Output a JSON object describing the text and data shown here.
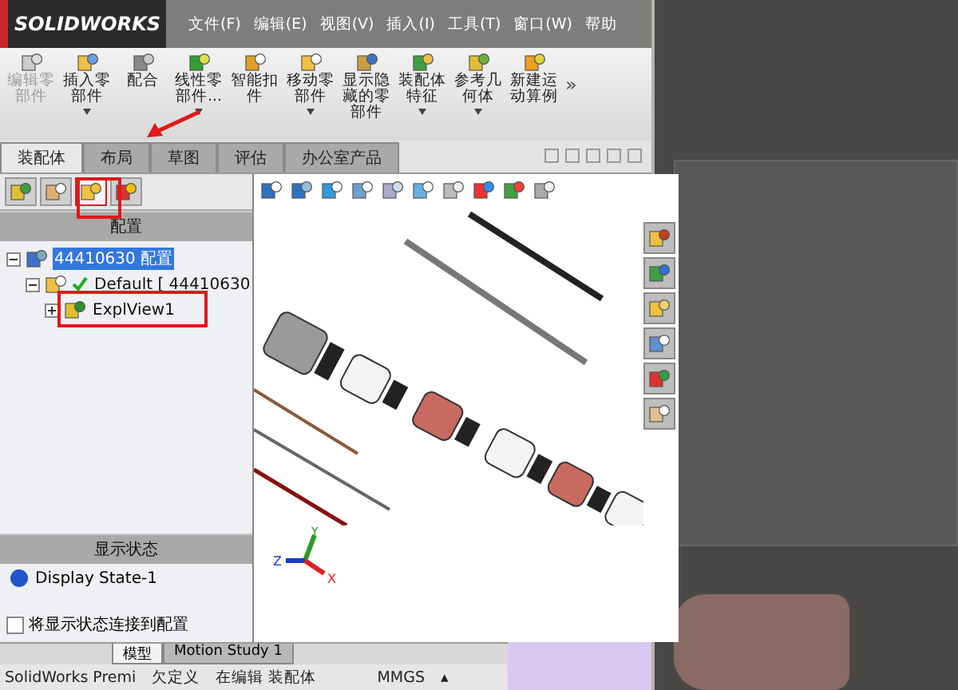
{
  "app": {
    "logo": "SOLIDWORKS",
    "menu": [
      "文件(F)",
      "编辑(E)",
      "视图(V)",
      "插入(I)",
      "工具(T)",
      "窗口(W)",
      "帮助"
    ]
  },
  "toolbar": {
    "buttons": [
      {
        "label": "编辑零部件",
        "disabled": true,
        "dropdown": false
      },
      {
        "label": "插入零部件",
        "disabled": false,
        "dropdown": true
      },
      {
        "label": "配合",
        "disabled": false,
        "dropdown": false
      },
      {
        "label": "线性零部件...",
        "disabled": false,
        "dropdown": true
      },
      {
        "label": "智能扣件",
        "disabled": false,
        "dropdown": false
      },
      {
        "label": "移动零部件",
        "disabled": false,
        "dropdown": true
      },
      {
        "label": "显示隐藏的零部件",
        "disabled": false,
        "dropdown": false
      },
      {
        "label": "装配体特征",
        "disabled": false,
        "dropdown": true
      },
      {
        "label": "参考几何体",
        "disabled": false,
        "dropdown": true
      },
      {
        "label": "新建运动算例",
        "disabled": false,
        "dropdown": false
      }
    ],
    "more": "»"
  },
  "tabs": [
    {
      "label": "装配体",
      "selected": true
    },
    {
      "label": "布局",
      "selected": false
    },
    {
      "label": "草图",
      "selected": false
    },
    {
      "label": "评估",
      "selected": false
    },
    {
      "label": "办公室产品",
      "selected": false
    }
  ],
  "panel_tabs": [
    {
      "selected": false
    },
    {
      "selected": false
    },
    {
      "selected": true
    },
    {
      "selected": false
    }
  ],
  "configurations": {
    "title": "配置",
    "tree": [
      {
        "label": "44410630 配置",
        "selected": true,
        "expanded": true,
        "children": [
          {
            "label": "Default [ 44410630",
            "selected": false,
            "expanded": true,
            "active": true,
            "children": [
              {
                "label": "ExplView1",
                "selected": false,
                "expanded": false
              }
            ]
          }
        ]
      }
    ]
  },
  "display_states": {
    "title": "显示状态",
    "items": [
      "Display State-1"
    ],
    "link_checkbox": {
      "label": "将显示状态连接到配置",
      "checked": false
    }
  },
  "triad": {
    "x": "X",
    "y": "Y",
    "z": "Z"
  },
  "bottom_tabs": [
    {
      "label": "模型",
      "selected": true
    },
    {
      "label": "Motion Study 1",
      "selected": false
    }
  ],
  "status_bar": [
    "SolidWorks Premi",
    "欠定义",
    "在编辑 装配体",
    "MMGS",
    "▴"
  ]
}
